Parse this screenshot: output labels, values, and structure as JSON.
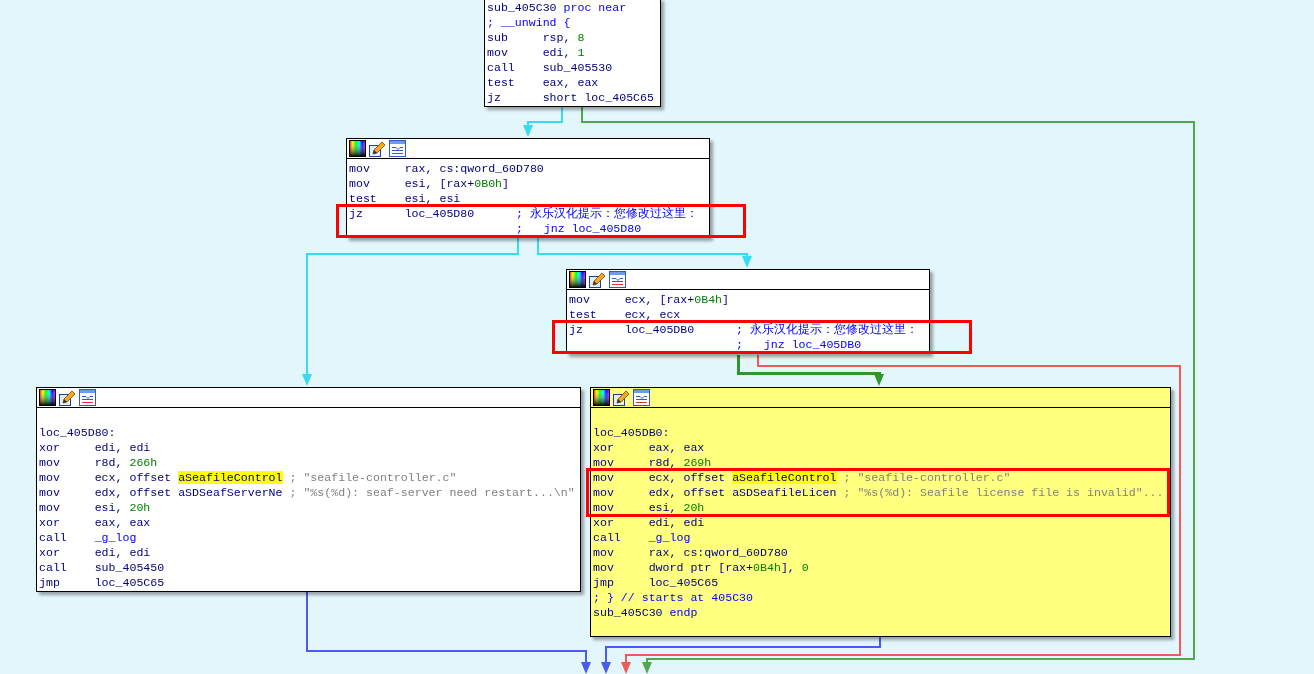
{
  "graph": {
    "nodes": [
      {
        "color": "#ffffff",
        "toolbar": false,
        "lines": [
          {
            "kind": "text",
            "parts": [
              {
                "text": "sub_405C30",
                "kind": "plain"
              },
              {
                "text": " proc near",
                "kind": "keyword"
              }
            ]
          },
          {
            "kind": "text",
            "parts": [
              {
                "text": "; __unwind {",
                "kind": "comment"
              }
            ]
          },
          {
            "kind": "instruction",
            "mnemonic": "sub",
            "operands": [
              {
                "text": "rsp, ",
                "kind": "plain"
              },
              {
                "text": "8",
                "kind": "number"
              }
            ]
          },
          {
            "kind": "instruction",
            "mnemonic": "mov",
            "operands": [
              {
                "text": "edi, ",
                "kind": "plain"
              },
              {
                "text": "1",
                "kind": "number"
              }
            ]
          },
          {
            "kind": "instruction",
            "mnemonic": "call",
            "operands": [
              {
                "text": "sub_405530",
                "kind": "plain"
              }
            ]
          },
          {
            "kind": "instruction",
            "mnemonic": "test",
            "operands": [
              {
                "text": "eax, eax",
                "kind": "plain"
              }
            ]
          },
          {
            "kind": "instruction",
            "mnemonic": "jz",
            "operands": [
              {
                "text": "short loc_405C65",
                "kind": "plain"
              }
            ]
          }
        ]
      },
      {
        "color": "#ffffff",
        "toolbar": true,
        "lines": [
          {
            "kind": "instruction",
            "mnemonic": "mov",
            "operands": [
              {
                "text": "rax, cs:qword_60D780",
                "kind": "plain"
              }
            ]
          },
          {
            "kind": "instruction",
            "mnemonic": "mov",
            "operands": [
              {
                "text": "esi, [rax+",
                "kind": "plain"
              },
              {
                "text": "0B0h",
                "kind": "number"
              },
              {
                "text": "]",
                "kind": "plain"
              }
            ]
          },
          {
            "kind": "instruction",
            "mnemonic": "test",
            "operands": [
              {
                "text": "esi, esi",
                "kind": "plain"
              }
            ]
          },
          {
            "kind": "annotation",
            "lines": [
              {
                "kind": "instruction",
                "mnemonic": "jz",
                "operands": [
                  {
                    "text": "loc_405D80",
                    "kind": "plain"
                  }
                ],
                "comment_lines": [
                  [
                    {
                      "text": "; 永乐汉化提示：您修改过这里：",
                      "kind": "comment"
                    }
                  ],
                  [
                    {
                      "text": ";   jnz loc_405D80",
                      "kind": "comment"
                    }
                  ]
                ]
              }
            ]
          }
        ]
      },
      {
        "color": "#ffffff",
        "toolbar": true,
        "lines": [
          {
            "kind": "instruction",
            "mnemonic": "mov",
            "operands": [
              {
                "text": "ecx, [rax+",
                "kind": "plain"
              },
              {
                "text": "0B4h",
                "kind": "number"
              },
              {
                "text": "]",
                "kind": "plain"
              }
            ]
          },
          {
            "kind": "instruction",
            "mnemonic": "test",
            "operands": [
              {
                "text": "ecx, ecx",
                "kind": "plain"
              }
            ]
          },
          {
            "kind": "annotation",
            "lines": [
              {
                "kind": "instruction",
                "mnemonic": "jz",
                "operands": [
                  {
                    "text": "loc_405DB0",
                    "kind": "plain"
                  }
                ],
                "comment_lines": [
                  [
                    {
                      "text": "; 永乐汉化提示：您修改过这里：",
                      "kind": "comment"
                    }
                  ],
                  [
                    {
                      "text": ";   jnz loc_405DB0",
                      "kind": "comment"
                    }
                  ]
                ]
              }
            ]
          }
        ]
      },
      {
        "color": "#ffffff",
        "toolbar": true,
        "lines": [
          {
            "kind": "blank"
          },
          {
            "kind": "text",
            "parts": [
              {
                "text": "loc_405D80:",
                "kind": "plain"
              }
            ]
          },
          {
            "kind": "instruction",
            "mnemonic": "xor",
            "operands": [
              {
                "text": "edi, edi",
                "kind": "plain"
              }
            ]
          },
          {
            "kind": "instruction",
            "mnemonic": "mov",
            "operands": [
              {
                "text": "r8d, ",
                "kind": "plain"
              },
              {
                "text": "266h",
                "kind": "number"
              }
            ]
          },
          {
            "kind": "instruction",
            "mnemonic": "mov",
            "operands": [
              {
                "text": "ecx, offset ",
                "kind": "plain"
              },
              {
                "text": "aSeafileControl",
                "kind": "highlight"
              }
            ],
            "comment_lines": [
              [
                {
                  "text": "; \"seafile-controller.c\"",
                  "kind": "string"
                }
              ]
            ]
          },
          {
            "kind": "instruction",
            "mnemonic": "mov",
            "operands": [
              {
                "text": "edx, offset aSDSeafServerNe",
                "kind": "plain"
              }
            ],
            "comment_lines": [
              [
                {
                  "text": "; \"%s(%d): seaf-server need restart...\\n\"",
                  "kind": "string"
                }
              ]
            ]
          },
          {
            "kind": "instruction",
            "mnemonic": "mov",
            "operands": [
              {
                "text": "esi, ",
                "kind": "plain"
              },
              {
                "text": "20h",
                "kind": "number"
              }
            ]
          },
          {
            "kind": "instruction",
            "mnemonic": "xor",
            "operands": [
              {
                "text": "eax, eax",
                "kind": "plain"
              }
            ]
          },
          {
            "kind": "instruction",
            "mnemonic": "call",
            "operands": [
              {
                "text": "_g_log",
                "kind": "name"
              }
            ]
          },
          {
            "kind": "instruction",
            "mnemonic": "xor",
            "operands": [
              {
                "text": "edi, edi",
                "kind": "plain"
              }
            ]
          },
          {
            "kind": "instruction",
            "mnemonic": "call",
            "operands": [
              {
                "text": "sub_405450",
                "kind": "plain"
              }
            ]
          },
          {
            "kind": "instruction",
            "mnemonic": "jmp",
            "operands": [
              {
                "text": "loc_405C65",
                "kind": "plain"
              }
            ]
          }
        ]
      },
      {
        "color": "#ffff80",
        "toolbar": true,
        "lines": [
          {
            "kind": "blank"
          },
          {
            "kind": "text",
            "parts": [
              {
                "text": "loc_405DB0:",
                "kind": "plain"
              }
            ]
          },
          {
            "kind": "instruction",
            "mnemonic": "xor",
            "operands": [
              {
                "text": "eax, eax",
                "kind": "plain"
              }
            ]
          },
          {
            "kind": "instruction",
            "mnemonic": "mov",
            "operands": [
              {
                "text": "r8d, ",
                "kind": "plain"
              },
              {
                "text": "269h",
                "kind": "number"
              }
            ]
          },
          {
            "kind": "annotation",
            "lines": [
              {
                "kind": "instruction",
                "mnemonic": "mov",
                "operands": [
                  {
                    "text": "ecx, offset ",
                    "kind": "plain"
                  },
                  {
                    "text": "aSeafileControl",
                    "kind": "highlight"
                  }
                ],
                "comment_lines": [
                  [
                    {
                      "text": "; \"seafile-controller.c\"",
                      "kind": "string"
                    }
                  ]
                ]
              },
              {
                "kind": "instruction",
                "mnemonic": "mov",
                "operands": [
                  {
                    "text": "edx, offset aSDSeafileLicen",
                    "kind": "plain"
                  }
                ],
                "comment_lines": [
                  [
                    {
                      "text": "; \"%s(%d): Seafile license file is invalid\"...",
                      "kind": "string"
                    }
                  ]
                ]
              },
              {
                "kind": "instruction",
                "mnemonic": "mov",
                "operands": [
                  {
                    "text": "esi, ",
                    "kind": "plain"
                  },
                  {
                    "text": "20h",
                    "kind": "number"
                  }
                ]
              }
            ]
          },
          {
            "kind": "instruction",
            "mnemonic": "xor",
            "operands": [
              {
                "text": "edi, edi",
                "kind": "plain"
              }
            ]
          },
          {
            "kind": "instruction",
            "mnemonic": "call",
            "operands": [
              {
                "text": "_g_log",
                "kind": "name"
              }
            ]
          },
          {
            "kind": "instruction",
            "mnemonic": "mov",
            "operands": [
              {
                "text": "rax, cs:qword_60D780",
                "kind": "plain"
              }
            ]
          },
          {
            "kind": "instruction",
            "mnemonic": "mov",
            "operands": [
              {
                "text": "dword ptr [rax+",
                "kind": "plain"
              },
              {
                "text": "0B4h",
                "kind": "number"
              },
              {
                "text": "], ",
                "kind": "plain"
              },
              {
                "text": "0",
                "kind": "number"
              }
            ]
          },
          {
            "kind": "instruction",
            "mnemonic": "jmp",
            "operands": [
              {
                "text": "loc_405C65",
                "kind": "plain"
              }
            ]
          },
          {
            "kind": "text",
            "parts": [
              {
                "text": "; } // starts at 405C30",
                "kind": "comment"
              }
            ]
          },
          {
            "kind": "text",
            "parts": [
              {
                "text": "sub_405C30",
                "kind": "plain"
              },
              {
                "text": " endp",
                "kind": "keyword"
              }
            ]
          },
          {
            "kind": "blank"
          }
        ]
      }
    ],
    "edges": [
      {
        "color": "#38dcf0"
      },
      {
        "color": "#52a852"
      },
      {
        "color": "#38dcf0"
      },
      {
        "color": "#38dcf0"
      },
      {
        "color": "#2f962f"
      },
      {
        "color": "#f05a5a"
      },
      {
        "color": "#4a5cf0"
      },
      {
        "color": "#4a5cf0"
      }
    ]
  }
}
